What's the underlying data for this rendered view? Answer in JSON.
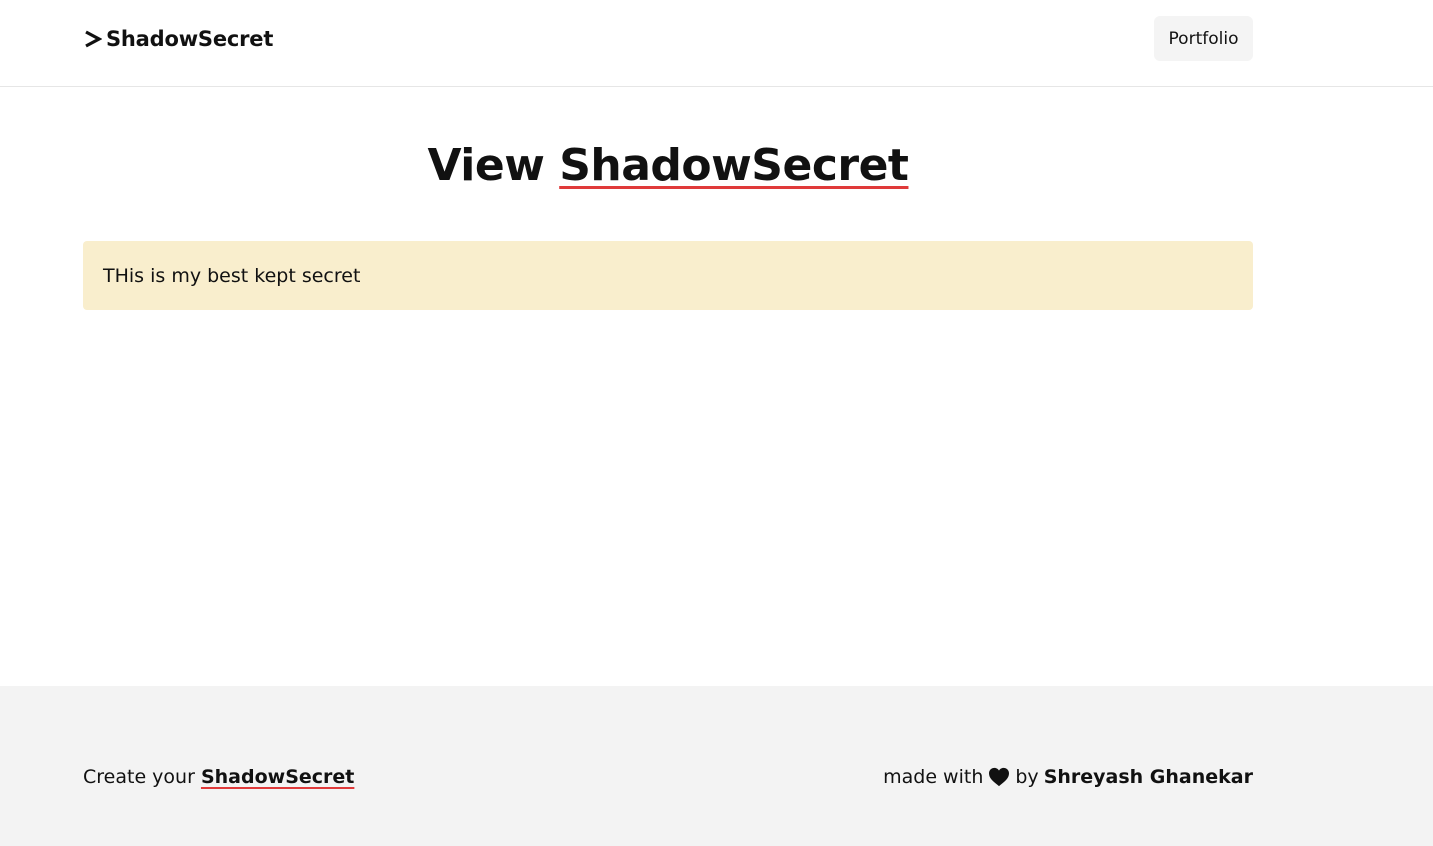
{
  "header": {
    "brand_name": "ShadowSecret",
    "portfolio_label": "Portfolio"
  },
  "main": {
    "title_prefix": "View",
    "title_highlight": "ShadowSecret",
    "secret_text": "THis is my best kept secret"
  },
  "footer": {
    "create_prefix": "Create your",
    "create_link": "ShadowSecret",
    "made_with": "made with",
    "by": "by",
    "author": "Shreyash Ghanekar"
  },
  "icons": {
    "brand": "chevron-right-icon",
    "love": "heart-icon"
  },
  "colors": {
    "accent_underline": "#e03a3a",
    "secret_background": "#f9eecd",
    "footer_background": "#f3f3f3",
    "button_background": "#f4f4f4"
  }
}
